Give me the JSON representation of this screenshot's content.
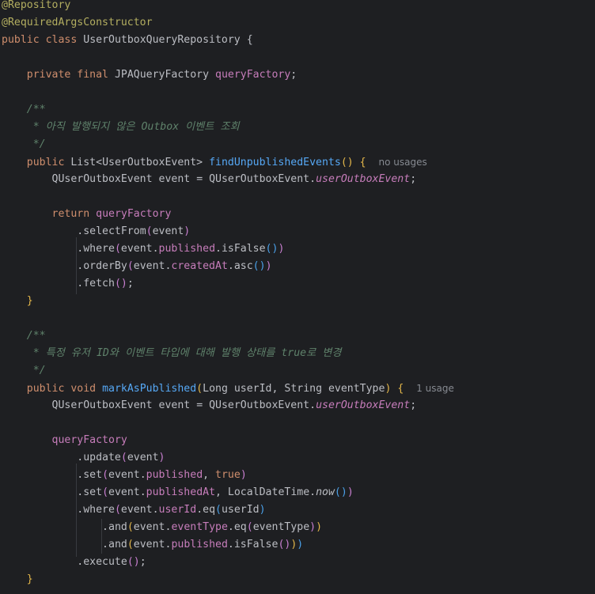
{
  "code": {
    "annotation_repository": "@Repository",
    "annotation_constructor": "@RequiredArgsConstructor",
    "kw_public": "public",
    "kw_class": "class",
    "kw_private": "private",
    "kw_final": "final",
    "kw_return": "return",
    "kw_void": "void",
    "kw_true": "true",
    "class_name": "UserOutboxQueryRepository",
    "type_factory": "JPAQueryFactory",
    "field_factory": "queryFactory",
    "type_list": "List",
    "type_event": "UserOutboxEvent",
    "type_qevent": "QUserOutboxEvent",
    "var_event": "event",
    "static_field": "userOutboxEvent",
    "doc_open": "/**",
    "doc_close": " */",
    "doc_comment1": " * 아직 발행되지 않은 Outbox 이벤트 조회",
    "doc_comment2": " * 특정 유저 ID와 이벤트 타입에 대해 발행 상태를 true로 변경",
    "method1": "findUnpublishedEvents",
    "method2": "markAsPublished",
    "type_long": "Long",
    "type_string": "String",
    "param_userId": "userId",
    "param_eventType": "eventType",
    "call_selectFrom": "selectFrom",
    "call_where": "where",
    "call_orderBy": "orderBy",
    "call_fetch": "fetch",
    "call_update": "update",
    "call_set": "set",
    "call_and": "and",
    "call_execute": "execute",
    "call_isFalse": "isFalse",
    "call_asc": "asc",
    "call_eq": "eq",
    "call_now": "now",
    "field_published": "published",
    "field_createdAt": "createdAt",
    "field_publishedAt": "publishedAt",
    "field_userId": "userId",
    "field_eventType": "eventType",
    "type_localDateTime": "LocalDateTime",
    "hint_no_usages": "no usages",
    "hint_one_usage": "1 usage"
  },
  "colors": {
    "background": "#1e1f22",
    "keyword": "#cf8e6d",
    "function": "#56a8f5",
    "field": "#c77dbb",
    "annotation": "#b3ae60",
    "doc_comment": "#5f826b",
    "text": "#bcbec4"
  }
}
